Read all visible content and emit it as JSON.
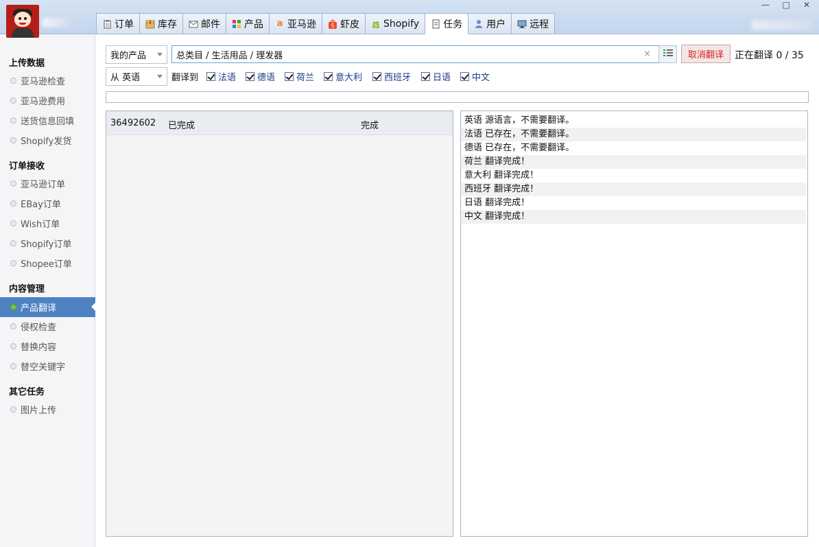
{
  "header": {
    "tabs": [
      {
        "label": "订单",
        "icon": "clipboard-icon"
      },
      {
        "label": "库存",
        "icon": "box-icon"
      },
      {
        "label": "邮件",
        "icon": "mail-icon"
      },
      {
        "label": "产品",
        "icon": "grid-icon"
      },
      {
        "label": "亚马逊",
        "icon": "amazon-icon"
      },
      {
        "label": "虾皮",
        "icon": "shopee-icon"
      },
      {
        "label": "Shopify",
        "icon": "shopify-icon"
      },
      {
        "label": "任务",
        "icon": "task-icon",
        "active": true
      },
      {
        "label": "用户",
        "icon": "user-icon"
      },
      {
        "label": "远程",
        "icon": "monitor-icon"
      }
    ],
    "window_controls": [
      "minimize-icon",
      "maximize-icon",
      "close-icon"
    ]
  },
  "sidebar": {
    "sections": [
      {
        "title": "上传数据",
        "items": [
          "亚马逊检查",
          "亚马逊费用",
          "送货信息回填",
          "Shopify发货"
        ]
      },
      {
        "title": "订单接收",
        "items": [
          "亚马逊订单",
          "EBay订单",
          "Wish订单",
          "Shopify订单",
          "Shopee订单"
        ]
      },
      {
        "title": "内容管理",
        "items": [
          "产品翻译",
          "侵权检查",
          "替换内容",
          "替空关键字"
        ]
      },
      {
        "title": "其它任务",
        "items": [
          "图片上传"
        ]
      }
    ],
    "active_item": "产品翻译"
  },
  "toolbar": {
    "scope_select": "我的产品",
    "category_path": "总类目 / 生活用品 / 理发器",
    "cancel_button": "取消翻译",
    "status_text": "正在翻译 0 / 35",
    "source_select": "从 英语",
    "translate_to_label": "翻译到",
    "languages": [
      {
        "label": "法语",
        "checked": true
      },
      {
        "label": "德语",
        "checked": true
      },
      {
        "label": "荷兰",
        "checked": true
      },
      {
        "label": "意大利",
        "checked": true
      },
      {
        "label": "西班牙",
        "checked": true
      },
      {
        "label": "日语",
        "checked": true
      },
      {
        "label": "中文",
        "checked": true
      }
    ],
    "progress": 0
  },
  "task_list": [
    {
      "id": "36492602",
      "state": "已完成",
      "result": "完成"
    }
  ],
  "log_lines": [
    "英语 源语言，不需要翻译。",
    "法语 已存在，不需要翻译。",
    "德语 已存在，不需要翻译。",
    "荷兰 翻译完成！",
    "意大利 翻译完成！",
    "西班牙 翻译完成！",
    "日语 翻译完成！",
    "中文 翻译完成！"
  ],
  "colors": {
    "accent": "#4f82c3",
    "cancel_text": "#d8241c",
    "active_dot": "#7ac142"
  }
}
